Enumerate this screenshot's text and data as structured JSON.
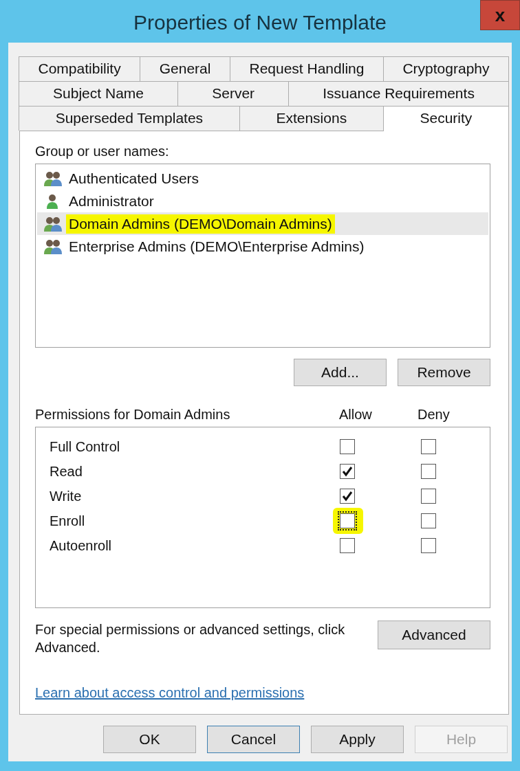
{
  "window": {
    "title": "Properties of New Template",
    "close": "x"
  },
  "tab_rows": [
    [
      {
        "label": "Compatibility",
        "selected": false
      },
      {
        "label": "General",
        "selected": false
      },
      {
        "label": "Request Handling",
        "selected": false
      },
      {
        "label": "Cryptography",
        "selected": false
      }
    ],
    [
      {
        "label": "Subject Name",
        "selected": false
      },
      {
        "label": "Server",
        "selected": false
      },
      {
        "label": "Issuance Requirements",
        "selected": false
      }
    ],
    [
      {
        "label": "Superseded Templates",
        "selected": false
      },
      {
        "label": "Extensions",
        "selected": false
      },
      {
        "label": "Security",
        "selected": true
      }
    ]
  ],
  "users_label": "Group or user names:",
  "users": [
    {
      "name": "Authenticated Users",
      "kind": "group",
      "selected": false,
      "highlighted": false
    },
    {
      "name": "Administrator",
      "kind": "user",
      "selected": false,
      "highlighted": false
    },
    {
      "name": "Domain Admins (DEMO\\Domain Admins)",
      "kind": "group",
      "selected": true,
      "highlighted": true
    },
    {
      "name": "Enterprise Admins (DEMO\\Enterprise Admins)",
      "kind": "group",
      "selected": false,
      "highlighted": false
    }
  ],
  "user_buttons": [
    "Add...",
    "Remove"
  ],
  "permissions_label": "Permissions for Domain Admins",
  "permission_columns": [
    "Allow",
    "Deny"
  ],
  "permissions": [
    {
      "name": "Full Control",
      "allow": false,
      "deny": false,
      "focused": false,
      "highlighted": false
    },
    {
      "name": "Read",
      "allow": true,
      "deny": false,
      "focused": false,
      "highlighted": false
    },
    {
      "name": "Write",
      "allow": true,
      "deny": false,
      "focused": false,
      "highlighted": false
    },
    {
      "name": "Enroll",
      "allow": false,
      "deny": false,
      "focused": true,
      "highlighted": true
    },
    {
      "name": "Autoenroll",
      "allow": false,
      "deny": false,
      "focused": false,
      "highlighted": false
    }
  ],
  "advanced_note": "For special permissions or advanced settings, click Advanced.",
  "advanced_button": "Advanced",
  "help_link": "Learn about access control and permissions",
  "buttons": [
    {
      "label": "OK",
      "disabled": false
    },
    {
      "label": "Cancel",
      "disabled": false
    },
    {
      "label": "Apply",
      "disabled": false
    },
    {
      "label": "Help",
      "disabled": true
    }
  ]
}
